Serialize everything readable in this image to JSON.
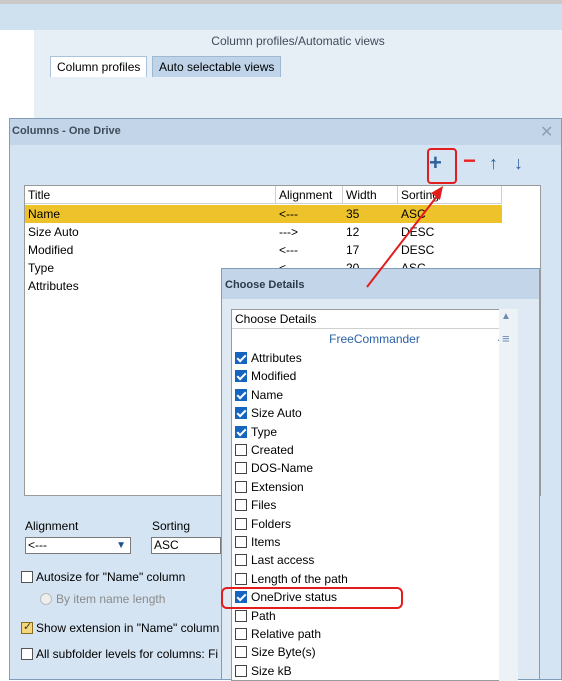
{
  "window": {
    "panel_title": "Column profiles/Automatic views",
    "tabs": [
      {
        "label": "Column profiles"
      },
      {
        "label": "Auto selectable views"
      }
    ]
  },
  "columns_dialog": {
    "title": "Columns - One Drive",
    "close_icon": "close-icon",
    "toolbar": {
      "add": "+",
      "remove": "−",
      "up": "↑",
      "down": "↓"
    },
    "headers": [
      "Title",
      "Alignment",
      "Width",
      "Sorting"
    ],
    "rows": [
      {
        "title": "Name",
        "alignment": "<---",
        "width": "35",
        "sorting": "ASC",
        "selected": true
      },
      {
        "title": "Size Auto",
        "alignment": "--->",
        "width": "12",
        "sorting": "DESC"
      },
      {
        "title": "Modified",
        "alignment": "<---",
        "width": "17",
        "sorting": "DESC"
      },
      {
        "title": "Type",
        "alignment": "<---",
        "width": "20",
        "sorting": "ASC"
      },
      {
        "title": "Attributes",
        "alignment": "",
        "width": "",
        "sorting": ""
      }
    ],
    "alignment_label": "Alignment",
    "alignment_value": "<---",
    "sorting_label": "Sorting",
    "sorting_value": "ASC",
    "autosize_label": "Autosize for \"Name\" column",
    "by_item_label": "By item name length",
    "show_ext_label": "Show extension in \"Name\" column",
    "subfolder_label": "All subfolder levels for columns: Fi"
  },
  "choose_details": {
    "title": "Choose Details",
    "header": "Choose Details",
    "group": "FreeCommander",
    "items": [
      {
        "label": "Attributes",
        "checked": true
      },
      {
        "label": "Modified",
        "checked": true
      },
      {
        "label": "Name",
        "checked": true
      },
      {
        "label": "Size Auto",
        "checked": true
      },
      {
        "label": "Type",
        "checked": true
      },
      {
        "label": "Created",
        "checked": false
      },
      {
        "label": "DOS-Name",
        "checked": false
      },
      {
        "label": "Extension",
        "checked": false
      },
      {
        "label": "Files",
        "checked": false
      },
      {
        "label": "Folders",
        "checked": false
      },
      {
        "label": "Items",
        "checked": false
      },
      {
        "label": "Last access",
        "checked": false
      },
      {
        "label": "Length of the path",
        "checked": false
      },
      {
        "label": "OneDrive status",
        "checked": true
      },
      {
        "label": "Path",
        "checked": false
      },
      {
        "label": "Relative path",
        "checked": false
      },
      {
        "label": "Size Byte(s)",
        "checked": false
      },
      {
        "label": "Size kB",
        "checked": false
      }
    ]
  },
  "colors": {
    "selection": "#eec22a",
    "annotation": "#e21d1d",
    "check_accent": "#1565c0"
  }
}
